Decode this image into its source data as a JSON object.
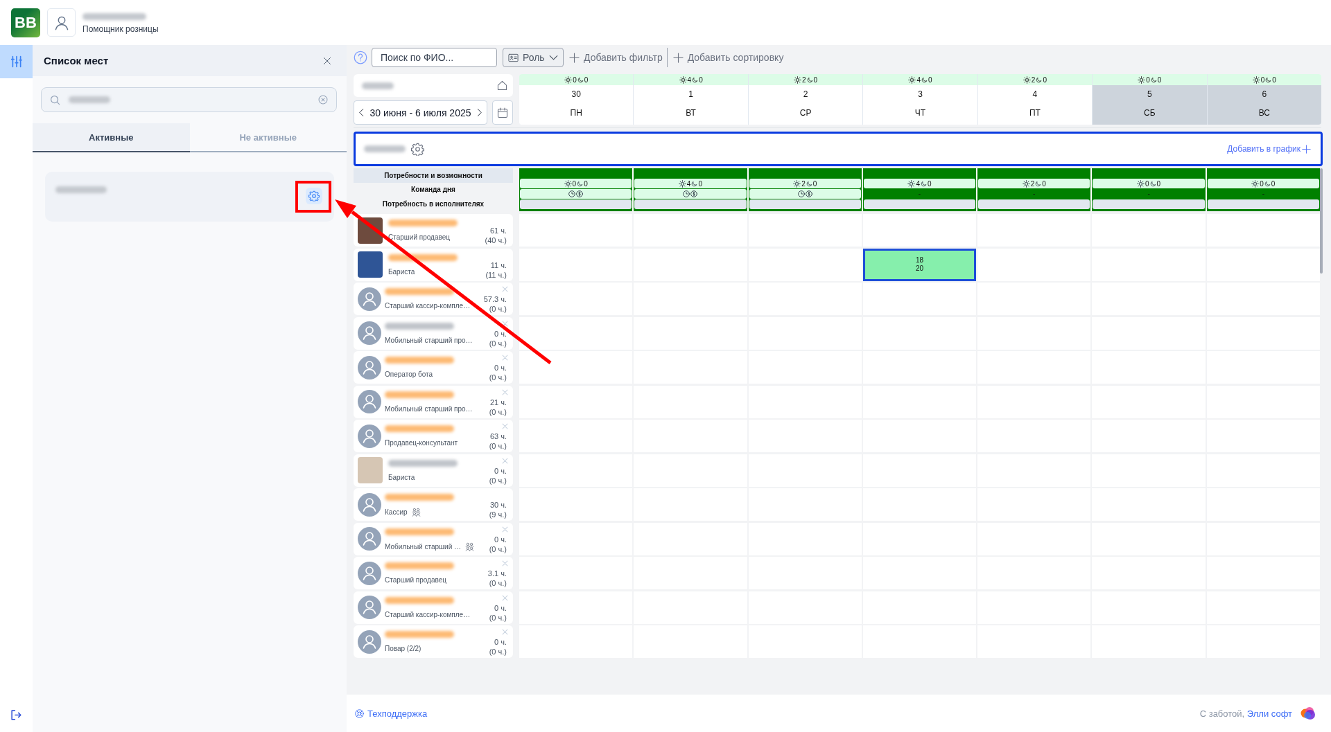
{
  "header": {
    "logo": "BB",
    "subtitle": "Помощник розницы"
  },
  "rail": {
    "items": [
      {
        "selected": true
      }
    ]
  },
  "sidebar": {
    "title": "Список мест",
    "tabs": [
      {
        "label": "Активные",
        "selected": true
      },
      {
        "label": "Не активные",
        "selected": false
      }
    ],
    "places": [
      {
        "highlighted": true
      }
    ]
  },
  "toolbar": {
    "search": {
      "placeholder": "Поиск по ФИО..."
    },
    "role": "Роль",
    "add_filter": "Добавить фильтр",
    "add_sort": "Добавить сортировку"
  },
  "week": {
    "range": "30 июня - 6 июля 2025"
  },
  "days": [
    {
      "sun": "0",
      "moon": "0",
      "date": "30",
      "weekday": "ПН",
      "weekend": false
    },
    {
      "sun": "4",
      "moon": "0",
      "date": "1",
      "weekday": "ВТ",
      "weekend": false
    },
    {
      "sun": "2",
      "moon": "0",
      "date": "2",
      "weekday": "СР",
      "weekend": false
    },
    {
      "sun": "4",
      "moon": "0",
      "date": "3",
      "weekday": "ЧТ",
      "weekend": false
    },
    {
      "sun": "2",
      "moon": "0",
      "date": "4",
      "weekday": "ПТ",
      "weekend": false
    },
    {
      "sun": "0",
      "moon": "0",
      "date": "5",
      "weekday": "СБ",
      "weekend": true
    },
    {
      "sun": "0",
      "moon": "0",
      "date": "6",
      "weekday": "ВС",
      "weekend": true
    }
  ],
  "group": {
    "selected": true,
    "add_label": "Добавить в график"
  },
  "needs": {
    "labels": [
      {
        "text": "Потребности и возможности",
        "highlighted": true
      },
      {
        "text": "Команда дня",
        "highlighted": false
      },
      {
        "text": "Потребность в исполнителях",
        "highlighted": false
      }
    ],
    "days": [
      {
        "sun": "0",
        "moon": "0",
        "team": {
          "kind": "icons"
        }
      },
      {
        "sun": "4",
        "moon": "0",
        "team": {
          "kind": "icons"
        }
      },
      {
        "sun": "2",
        "moon": "0",
        "team": {
          "kind": "icons"
        }
      },
      {
        "sun": "4",
        "moon": "0",
        "team": {
          "kind": "text",
          "text": "-"
        }
      },
      {
        "sun": "2",
        "moon": "0",
        "team": {
          "kind": "text",
          "text": "-"
        }
      },
      {
        "sun": "0",
        "moon": "0",
        "team": {
          "kind": "text",
          "text": "-"
        }
      },
      {
        "sun": "0",
        "moon": "0",
        "team": {
          "kind": "text",
          "text": "-"
        }
      }
    ]
  },
  "employees": [
    {
      "color": "#fdba74",
      "avatar": {
        "kind": "photo",
        "color": "#6e4b3e"
      },
      "role": "Старший продавец",
      "team": false,
      "hours": "61 ч.",
      "planned": "(40 ч.)",
      "removable": false,
      "cells": [
        {
          "kind": "empty"
        },
        {
          "kind": "empty"
        },
        {
          "kind": "empty"
        },
        {
          "kind": "empty"
        },
        {
          "kind": "empty"
        },
        {
          "kind": "empty"
        },
        {
          "kind": "empty"
        }
      ]
    },
    {
      "color": "#fdba74",
      "avatar": {
        "kind": "photo",
        "color": "#2f5596"
      },
      "role": "Бариста",
      "team": false,
      "hours": "11 ч.",
      "planned": "(11 ч.)",
      "removable": false,
      "cells": [
        {
          "kind": "empty"
        },
        {
          "kind": "empty"
        },
        {
          "kind": "empty"
        },
        {
          "kind": "shift",
          "lines": [
            "18",
            "20"
          ],
          "selected": true
        },
        {
          "kind": "empty"
        },
        {
          "kind": "empty"
        },
        {
          "kind": "empty"
        }
      ]
    },
    {
      "color": "#fdba74",
      "avatar": {
        "kind": "default"
      },
      "role": "Старший кассир-компле…",
      "team": false,
      "hours": "57.3 ч.",
      "planned": "(0 ч.)",
      "removable": true,
      "cells": [
        {
          "kind": "empty"
        },
        {
          "kind": "empty"
        },
        {
          "kind": "empty"
        },
        {
          "kind": "empty"
        },
        {
          "kind": "empty"
        },
        {
          "kind": "empty"
        },
        {
          "kind": "empty"
        }
      ]
    },
    {
      "color": "#c0c4ca",
      "avatar": {
        "kind": "default"
      },
      "role": "Мобильный старший про…",
      "team": false,
      "hours": "0 ч.",
      "planned": "(0 ч.)",
      "removable": true,
      "cells": [
        {
          "kind": "empty"
        },
        {
          "kind": "empty"
        },
        {
          "kind": "empty"
        },
        {
          "kind": "empty"
        },
        {
          "kind": "empty"
        },
        {
          "kind": "empty"
        },
        {
          "kind": "empty"
        }
      ]
    },
    {
      "color": "#fdba74",
      "avatar": {
        "kind": "default"
      },
      "role": "Оператор бота",
      "team": false,
      "hours": "0 ч.",
      "planned": "(0 ч.)",
      "removable": true,
      "cells": [
        {
          "kind": "empty"
        },
        {
          "kind": "empty"
        },
        {
          "kind": "empty"
        },
        {
          "kind": "empty"
        },
        {
          "kind": "empty"
        },
        {
          "kind": "empty"
        },
        {
          "kind": "empty"
        }
      ]
    },
    {
      "color": "#fdba74",
      "avatar": {
        "kind": "default"
      },
      "role": "Мобильный старший про…",
      "team": false,
      "hours": "21 ч.",
      "planned": "(0 ч.)",
      "removable": true,
      "cells": [
        {
          "kind": "empty"
        },
        {
          "kind": "empty"
        },
        {
          "kind": "empty"
        },
        {
          "kind": "empty"
        },
        {
          "kind": "empty"
        },
        {
          "kind": "empty"
        },
        {
          "kind": "empty"
        }
      ]
    },
    {
      "color": "#fdba74",
      "avatar": {
        "kind": "default"
      },
      "role": "Продавец-консультант",
      "team": false,
      "hours": "63 ч.",
      "planned": "(0 ч.)",
      "removable": true,
      "cells": [
        {
          "kind": "empty"
        },
        {
          "kind": "empty"
        },
        {
          "kind": "empty"
        },
        {
          "kind": "empty"
        },
        {
          "kind": "empty"
        },
        {
          "kind": "empty"
        },
        {
          "kind": "empty"
        }
      ]
    },
    {
      "color": "#c0c4ca",
      "avatar": {
        "kind": "photo",
        "color": "#d6c6b4"
      },
      "role": "Бариста",
      "team": false,
      "hours": "0 ч.",
      "planned": "(0 ч.)",
      "removable": true,
      "cells": [
        {
          "kind": "empty"
        },
        {
          "kind": "empty"
        },
        {
          "kind": "empty"
        },
        {
          "kind": "empty"
        },
        {
          "kind": "empty"
        },
        {
          "kind": "empty"
        },
        {
          "kind": "empty"
        }
      ]
    },
    {
      "color": "#fdba74",
      "avatar": {
        "kind": "default"
      },
      "role": "Кассир",
      "team": true,
      "hours": "30 ч.",
      "planned": "(9 ч.)",
      "removable": false,
      "cells": [
        {
          "kind": "empty"
        },
        {
          "kind": "empty"
        },
        {
          "kind": "empty"
        },
        {
          "kind": "empty"
        },
        {
          "kind": "empty"
        },
        {
          "kind": "empty"
        },
        {
          "kind": "empty"
        }
      ]
    },
    {
      "color": "#fdba74",
      "avatar": {
        "kind": "default"
      },
      "role": "Мобильный старший …",
      "team": true,
      "hours": "0 ч.",
      "planned": "(0 ч.)",
      "removable": true,
      "cells": [
        {
          "kind": "empty"
        },
        {
          "kind": "empty"
        },
        {
          "kind": "empty"
        },
        {
          "kind": "empty"
        },
        {
          "kind": "empty"
        },
        {
          "kind": "empty"
        },
        {
          "kind": "empty"
        }
      ]
    },
    {
      "color": "#fdba74",
      "avatar": {
        "kind": "default"
      },
      "role": "Старший продавец",
      "team": false,
      "hours": "3.1 ч.",
      "planned": "(0 ч.)",
      "removable": true,
      "cells": [
        {
          "kind": "empty"
        },
        {
          "kind": "empty"
        },
        {
          "kind": "empty"
        },
        {
          "kind": "empty"
        },
        {
          "kind": "empty"
        },
        {
          "kind": "empty"
        },
        {
          "kind": "empty"
        }
      ]
    },
    {
      "color": "#fdba74",
      "avatar": {
        "kind": "default"
      },
      "role": "Старший кассир-компле…",
      "team": false,
      "hours": "0 ч.",
      "planned": "(0 ч.)",
      "removable": true,
      "cells": [
        {
          "kind": "empty"
        },
        {
          "kind": "empty"
        },
        {
          "kind": "empty"
        },
        {
          "kind": "empty"
        },
        {
          "kind": "empty"
        },
        {
          "kind": "empty"
        },
        {
          "kind": "empty"
        }
      ]
    },
    {
      "color": "#fdba74",
      "avatar": {
        "kind": "default"
      },
      "role": "Повар (2/2)",
      "team": false,
      "hours": "0 ч.",
      "planned": "(0 ч.)",
      "removable": true,
      "cells": [
        {
          "kind": "empty"
        },
        {
          "kind": "empty"
        },
        {
          "kind": "empty"
        },
        {
          "kind": "empty"
        },
        {
          "kind": "empty"
        },
        {
          "kind": "empty"
        },
        {
          "kind": "empty"
        }
      ]
    }
  ],
  "footer": {
    "support": "Техподдержка",
    "credit": "С заботой,",
    "credit_link": "Элли софт"
  }
}
